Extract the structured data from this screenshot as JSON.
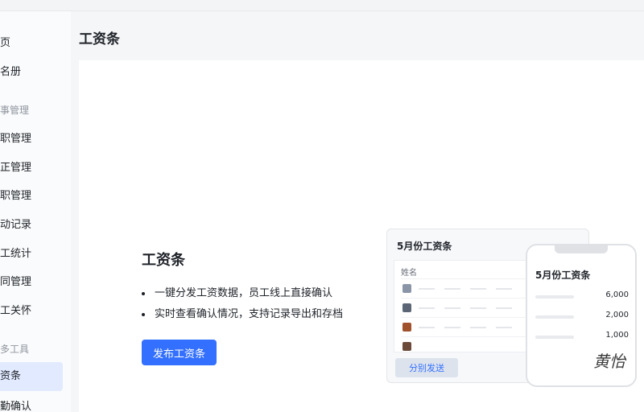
{
  "sidebar": {
    "items": [
      {
        "label": "页",
        "type": "item"
      },
      {
        "label": "名册",
        "type": "item"
      },
      {
        "label": "事管理",
        "type": "group"
      },
      {
        "label": "职管理",
        "type": "item"
      },
      {
        "label": "正管理",
        "type": "item"
      },
      {
        "label": "职管理",
        "type": "item"
      },
      {
        "label": "动记录",
        "type": "item"
      },
      {
        "label": "工统计",
        "type": "item"
      },
      {
        "label": "同管理",
        "type": "item"
      },
      {
        "label": "工关怀",
        "type": "item"
      },
      {
        "label": "多工具",
        "type": "group"
      },
      {
        "label": "资条",
        "type": "item",
        "active": true
      },
      {
        "label": "勤确认",
        "type": "item"
      }
    ]
  },
  "header": {
    "title": "工资条"
  },
  "feature": {
    "title": "工资条",
    "bullets": [
      "一键分发工资数据，员工线上直接确认",
      "实时查看确认情况，支持记录导出和存档"
    ],
    "publish_label": "发布工资条"
  },
  "illustration": {
    "card_title": "5月份工资条",
    "table_header": "姓名",
    "split_send_label": "分别发送",
    "phone_title": "5月份工资条",
    "phone_values": [
      "6,000",
      "2,000",
      "1,000"
    ],
    "signature": "黄怡"
  },
  "colors": {
    "accent": "#3370ff",
    "active_bg": "#e1eaff"
  }
}
